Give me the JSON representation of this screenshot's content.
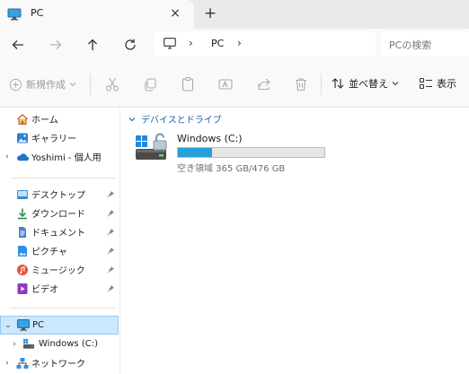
{
  "tab": {
    "title": "PC",
    "close": "×",
    "new": "+"
  },
  "nav": {
    "path": "PC",
    "search_placeholder": "PCの検索"
  },
  "commands": {
    "new_label": "新規作成",
    "sort_label": "並べ替え",
    "view_label": "表示"
  },
  "sidebar": {
    "quick": [
      {
        "label": "ホーム",
        "icon": "home-icon"
      },
      {
        "label": "ギャラリー",
        "icon": "gallery-icon"
      },
      {
        "label": "Yoshimi - 個人用",
        "icon": "onedrive-cloud-icon"
      }
    ],
    "pinned": [
      {
        "label": "デスクトップ",
        "icon": "desktop-folder-icon"
      },
      {
        "label": "ダウンロード",
        "icon": "download-icon"
      },
      {
        "label": "ドキュメント",
        "icon": "document-icon"
      },
      {
        "label": "ピクチャ",
        "icon": "pictures-icon"
      },
      {
        "label": "ミュージック",
        "icon": "music-icon"
      },
      {
        "label": "ビデオ",
        "icon": "video-icon"
      }
    ],
    "tree": [
      {
        "label": "PC",
        "icon": "pc-icon"
      },
      {
        "label": "Windows (C:)",
        "icon": "drive-icon"
      },
      {
        "label": "ネットワーク",
        "icon": "network-icon"
      }
    ]
  },
  "main": {
    "group_label": "デバイスとドライブ",
    "drive": {
      "name": "Windows (C:)",
      "info": "空き領域 365 GB/476 GB",
      "used_fraction": 0.233
    }
  },
  "colors": {
    "accent": "#26a0da",
    "selected_bg": "#cce8ff",
    "group_text": "#1b5fa8"
  }
}
